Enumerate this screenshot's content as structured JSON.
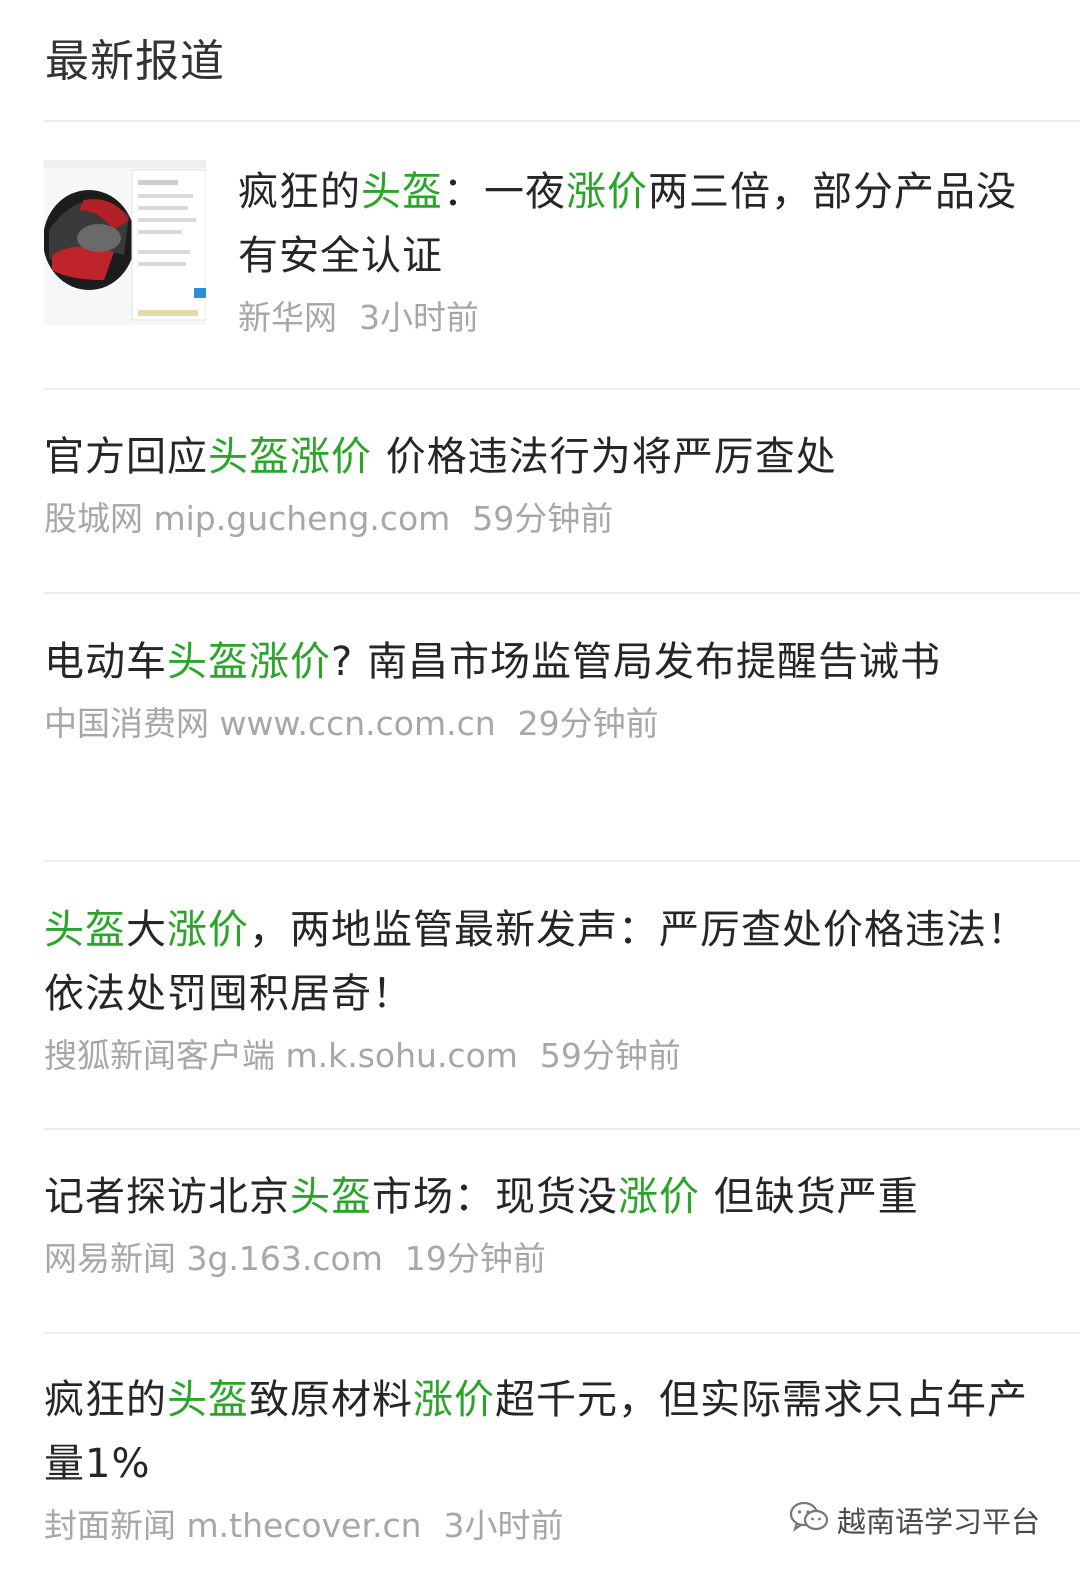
{
  "section_title": "最新报道",
  "items": [
    {
      "headline_parts": [
        {
          "t": "疯狂的",
          "hl": false
        },
        {
          "t": "头盔",
          "hl": true
        },
        {
          "t": "：一夜",
          "hl": false
        },
        {
          "t": "涨价",
          "hl": true
        },
        {
          "t": "两三倍，部分产品没有安全认证",
          "hl": false
        }
      ],
      "source": "新华网",
      "time": "3小时前",
      "has_thumbnail": true
    },
    {
      "headline_parts": [
        {
          "t": "官方回应",
          "hl": false
        },
        {
          "t": "头盔涨价",
          "hl": true
        },
        {
          "t": " 价格违法行为将严厉查处",
          "hl": false
        }
      ],
      "source": "股城网 mip.gucheng.com",
      "time": "59分钟前"
    },
    {
      "headline_parts": [
        {
          "t": "电动车",
          "hl": false
        },
        {
          "t": "头盔涨价",
          "hl": true
        },
        {
          "t": "? 南昌市场监管局发布提醒告诫书",
          "hl": false
        }
      ],
      "source": "中国消费网 www.ccn.com.cn",
      "time": "29分钟前"
    },
    {
      "headline_parts": [
        {
          "t": "头盔",
          "hl": true
        },
        {
          "t": "大",
          "hl": false
        },
        {
          "t": "涨价",
          "hl": true
        },
        {
          "t": "，两地监管最新发声：严厉查处价格违法！依法处罚囤积居奇！",
          "hl": false
        }
      ],
      "source": "搜狐新闻客户端 m.k.sohu.com",
      "time": "59分钟前"
    },
    {
      "headline_parts": [
        {
          "t": "记者探访北京",
          "hl": false
        },
        {
          "t": "头盔",
          "hl": true
        },
        {
          "t": "市场：现货没",
          "hl": false
        },
        {
          "t": "涨价",
          "hl": true
        },
        {
          "t": " 但缺货严重",
          "hl": false
        }
      ],
      "source": "网易新闻 3g.163.com",
      "time": "19分钟前"
    },
    {
      "headline_parts": [
        {
          "t": "疯狂的",
          "hl": false
        },
        {
          "t": "头盔",
          "hl": true
        },
        {
          "t": "致原材料",
          "hl": false
        },
        {
          "t": "涨价",
          "hl": true
        },
        {
          "t": "超千元，但实际需求只占年产量1%",
          "hl": false
        }
      ],
      "source": "封面新闻 m.thecover.cn",
      "time": "3小时前"
    }
  ],
  "watermark": {
    "text": "越南语学习平台",
    "icon": "wechat-icon"
  },
  "colors": {
    "highlight": "#2aa52a",
    "text": "#262626",
    "meta": "#a7a7a7",
    "divider": "#ececec"
  }
}
